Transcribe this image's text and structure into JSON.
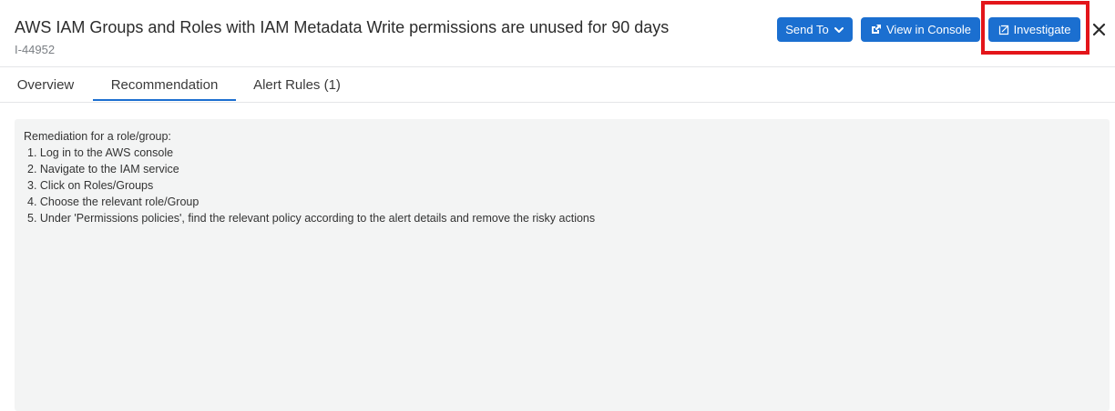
{
  "header": {
    "title": "AWS IAM Groups and Roles with IAM Metadata Write permissions are unused for 90 days",
    "id": "I-44952"
  },
  "actions": {
    "send_to": "Send To",
    "view_in_console": "View in Console",
    "investigate": "Investigate"
  },
  "tabs": [
    {
      "label": "Overview",
      "active": false
    },
    {
      "label": "Recommendation",
      "active": true
    },
    {
      "label": "Alert Rules (1)",
      "active": false
    }
  ],
  "recommendation": {
    "heading": "Remediation for a role/group:",
    "steps": [
      "1. Log in to the AWS console",
      "2. Navigate to the IAM service",
      "3. Click on Roles/Groups",
      "4. Choose the relevant role/Group",
      "5. Under 'Permissions policies', find the relevant policy according to the alert details and remove the risky actions"
    ]
  },
  "colors": {
    "accent": "#1b6fd0",
    "highlight_box": "#e3151a",
    "panel_bg": "#f3f4f4"
  },
  "icons": {
    "send_to": "chevron-down-icon",
    "view_in_console": "external-link-icon",
    "investigate": "investigate-icon",
    "close": "close-icon"
  }
}
